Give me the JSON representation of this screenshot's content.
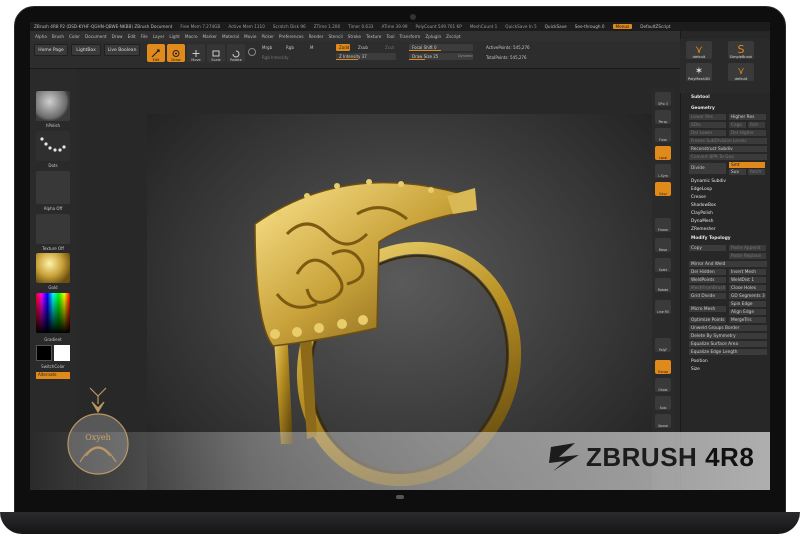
{
  "titlebar": {
    "document": "ZBrush 4R8 P2 (DSD-KYHF-QGHN-QBWE-NKBB)  ZBrush Document",
    "free_mem": "Free Mem 7.274GB",
    "active_mem": "Active Mem 1110",
    "scratch_disk": "Scratch Disk 96",
    "ztime": "ZTime 1.206",
    "timer": "Timer 0.633",
    "atime": "ATime 39.99",
    "poly_count": "PolyCount 549.701 KP",
    "mesh_count": "MeshCount 1",
    "quicksave_in": "QuickSave In 5",
    "quicksave": "QuickSave",
    "see_through": "See-through 0",
    "menus": "Menus",
    "default_script": "DefaultZScript"
  },
  "menubar": [
    "Alpha",
    "Brush",
    "Color",
    "Document",
    "Draw",
    "Edit",
    "File",
    "Layer",
    "Light",
    "Macro",
    "Marker",
    "Material",
    "Movie",
    "Picker",
    "Preferences",
    "Render",
    "Stencil",
    "Stroke",
    "Texture",
    "Tool",
    "Transform",
    "Zplugin",
    "Zscript"
  ],
  "toolbar": {
    "home_page": "Home Page",
    "lightbox": "LightBox",
    "live_boolean": "Live Boolean",
    "edit": "Edit",
    "draw": "Draw",
    "move": "Move",
    "scale": "Scale",
    "rotate": "Rotate",
    "mrgb": "Mrgb",
    "rgb": "Rgb",
    "m": "M",
    "rgb_intensity": "Rgb Intensity",
    "zadd": "Zadd",
    "zsub": "Zsub",
    "zcut": "Zcut",
    "z_intensity": "Z Intensity 37",
    "focal_shift": "Focal Shift 0",
    "draw_size": "Draw Size 25",
    "dynamic": "Dynamic",
    "active_points": "ActivePoints: 545,276",
    "total_points": "TotalPoints: 545,276"
  },
  "left_shelf": {
    "brush_label": "hPolish",
    "stroke_label": "Dots",
    "alpha_label": "Alpha Off",
    "texture_label": "Texture Off",
    "material_label": "Gold",
    "gradient_label": "Gradient",
    "switch_color": "SwitchColor",
    "alternate": "Alternate"
  },
  "right_shelf": [
    "SPix 3",
    "Persp",
    "Floor",
    "Local",
    "L.Sym",
    "Qxyz",
    "Frame",
    "Move",
    "Scale",
    "Rotate",
    "Line Fill",
    "PolyF",
    "Transp",
    "Ghost",
    "Solo",
    "Xpose"
  ],
  "tray": {
    "brushes": [
      "default",
      "SimpleBrush",
      "PolyMesh3D",
      "default"
    ],
    "subtool": "Subtool",
    "geometry": "Geometry",
    "rows": {
      "lower_res": "Lower Res",
      "higher_res": "Higher Res",
      "sdiv": "SDiv",
      "cage": "Cage",
      "rstr": "Rstr",
      "del_lower": "Del Lower",
      "del_higher": "Del Higher",
      "freeze_subdiv": "Freeze SubDivision Levels",
      "reconstruct_subdiv": "Reconstruct Subdiv",
      "convert_bpr": "Convert BPR To Geo",
      "divide": "Divide",
      "smt": "Smt",
      "suv": "Suv",
      "reuv": "ReUV",
      "dynamic_subdiv": "Dynamic Subdiv",
      "edgeloop": "EdgeLoop",
      "crease": "Crease",
      "shadowbox": "ShadowBox",
      "claypolish": "ClayPolish",
      "dynamesh": "DynaMesh",
      "zremesher": "ZRemesher",
      "modify_topology": "Modify Topology",
      "copy": "Copy",
      "paste_append": "Paste Append",
      "paste_replace": "Paste Replace",
      "mirror_and_weld": "Mirror And Weld",
      "del_hidden": "Del Hidden",
      "insert_mesh": "Insert Mesh",
      "weld_points": "WeldPoints",
      "weld_dist": "WeldDist 1",
      "meshfromb": "MeshFromBrush",
      "close_holes": "Close Holes",
      "grid_divide": "Grid Divide",
      "gd_segments": "GD Segments 3",
      "spin_edge": "Spin Edge",
      "micro_mesh": "Micro Mesh",
      "align_edge": "Align Edge",
      "optimize_points": "Optimize Points",
      "merge_tris": "MergeTris",
      "unweld_groups": "Unweld Groups Border",
      "delete_by_symmetry": "Delete By Symmetry",
      "equalize_surface": "Equalize Surface Area",
      "equalize_edge": "Equalize Edge Length",
      "position": "Position",
      "size": "Size"
    }
  },
  "banner": {
    "product": "ZBRUSH",
    "version": "4R8"
  },
  "watermark": {
    "text": "Oxyeh"
  },
  "colors": {
    "accent": "#e08a1b",
    "ui_bg": "#282828",
    "gold": "#b8962e"
  }
}
